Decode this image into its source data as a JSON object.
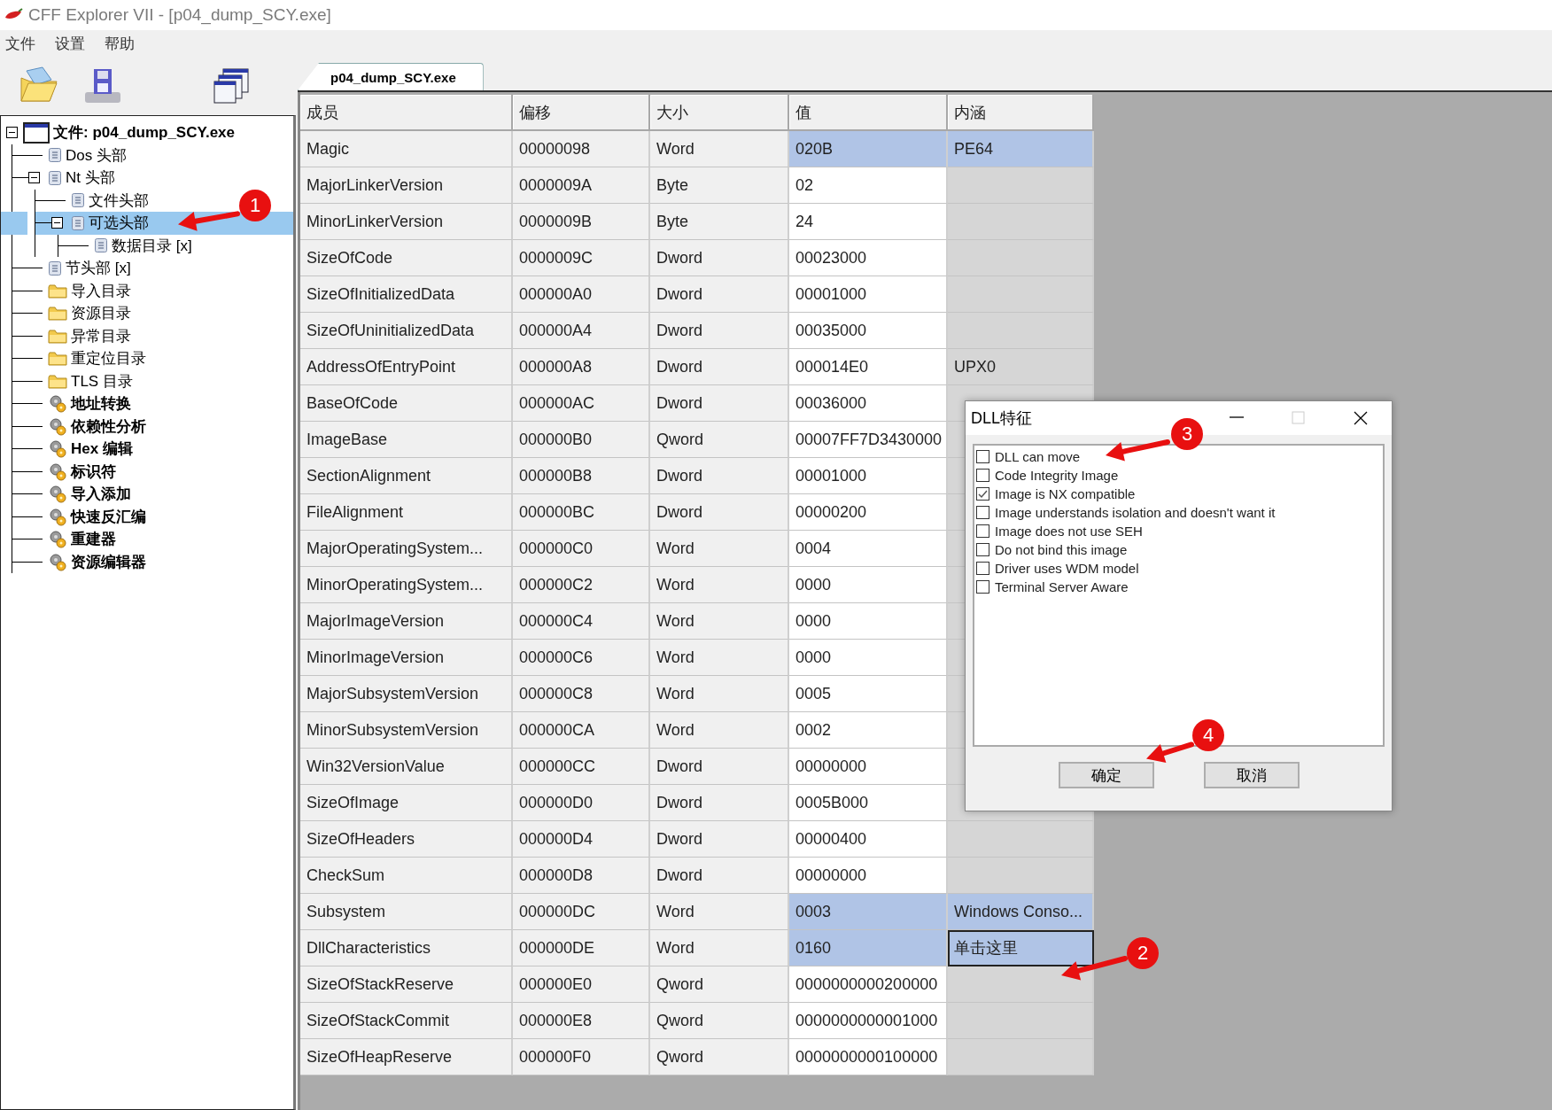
{
  "window": {
    "title": "CFF Explorer VII - [p04_dump_SCY.exe]"
  },
  "menu": [
    "文件",
    "设置",
    "帮助"
  ],
  "toolbar": [
    {
      "kind": "open"
    },
    {
      "kind": "save"
    },
    {
      "kind": "windows"
    }
  ],
  "tree": [
    {
      "label": "文件: p04_dump_SCY.exe",
      "kind": "window",
      "expanded": true,
      "selected": false,
      "children": [
        {
          "label": "Dos 头部",
          "kind": "doc",
          "selected": false
        },
        {
          "label": "Nt 头部",
          "kind": "doc",
          "expanded": true,
          "selected": false,
          "children": [
            {
              "label": "文件头部",
              "kind": "doc",
              "selected": false
            },
            {
              "label": "可选头部",
              "kind": "doc",
              "expanded": true,
              "selected": true,
              "children": [
                {
                  "label": "数据目录 [x]",
                  "kind": "doc",
                  "selected": false
                }
              ]
            }
          ]
        },
        {
          "label": "节头部 [x]",
          "kind": "doc",
          "selected": false
        },
        {
          "label": "导入目录",
          "kind": "folder",
          "selected": false
        },
        {
          "label": "资源目录",
          "kind": "folder",
          "selected": false
        },
        {
          "label": "异常目录",
          "kind": "folder",
          "selected": false
        },
        {
          "label": "重定位目录",
          "kind": "folder",
          "selected": false
        },
        {
          "label": "TLS 目录",
          "kind": "folder",
          "selected": false
        },
        {
          "label": "地址转换",
          "kind": "tool",
          "selected": false
        },
        {
          "label": "依赖性分析",
          "kind": "tool",
          "selected": false
        },
        {
          "label": "Hex 编辑",
          "kind": "tool",
          "selected": false
        },
        {
          "label": "标识符",
          "kind": "tool",
          "selected": false
        },
        {
          "label": "导入添加",
          "kind": "tool",
          "selected": false
        },
        {
          "label": "快速反汇编",
          "kind": "tool",
          "selected": false
        },
        {
          "label": "重建器",
          "kind": "tool",
          "selected": false
        },
        {
          "label": "资源编辑器",
          "kind": "tool",
          "selected": false
        }
      ]
    }
  ],
  "tabs": [
    {
      "label": "p04_dump_SCY.exe",
      "selected": true
    }
  ],
  "table": {
    "columns": [
      "成员",
      "偏移",
      "大小",
      "值",
      "内涵"
    ],
    "rows": [
      {
        "cells": [
          "Magic",
          "00000098",
          "Word",
          "020B",
          "PE64"
        ],
        "selected": true,
        "focused": false
      },
      {
        "cells": [
          "MajorLinkerVersion",
          "0000009A",
          "Byte",
          "02"
        ],
        "selected": false,
        "focused": false
      },
      {
        "cells": [
          "MinorLinkerVersion",
          "0000009B",
          "Byte",
          "24"
        ],
        "selected": false,
        "focused": false
      },
      {
        "cells": [
          "SizeOfCode",
          "0000009C",
          "Dword",
          "00023000"
        ],
        "selected": false,
        "focused": false
      },
      {
        "cells": [
          "SizeOfInitializedData",
          "000000A0",
          "Dword",
          "00001000"
        ],
        "selected": false,
        "focused": false
      },
      {
        "cells": [
          "SizeOfUninitializedData",
          "000000A4",
          "Dword",
          "00035000"
        ],
        "selected": false,
        "focused": false
      },
      {
        "cells": [
          "AddressOfEntryPoint",
          "000000A8",
          "Dword",
          "000014E0",
          "UPX0"
        ],
        "selected": false,
        "focused": false
      },
      {
        "cells": [
          "BaseOfCode",
          "000000AC",
          "Dword",
          "00036000"
        ],
        "selected": false,
        "focused": false
      },
      {
        "cells": [
          "ImageBase",
          "000000B0",
          "Qword",
          "00007FF7D3430000"
        ],
        "selected": false,
        "focused": false
      },
      {
        "cells": [
          "SectionAlignment",
          "000000B8",
          "Dword",
          "00001000"
        ],
        "selected": false,
        "focused": false
      },
      {
        "cells": [
          "FileAlignment",
          "000000BC",
          "Dword",
          "00000200"
        ],
        "selected": false,
        "focused": false
      },
      {
        "cells": [
          "MajorOperatingSystem...",
          "000000C0",
          "Word",
          "0004"
        ],
        "selected": false,
        "focused": false
      },
      {
        "cells": [
          "MinorOperatingSystem...",
          "000000C2",
          "Word",
          "0000"
        ],
        "selected": false,
        "focused": false
      },
      {
        "cells": [
          "MajorImageVersion",
          "000000C4",
          "Word",
          "0000"
        ],
        "selected": false,
        "focused": false
      },
      {
        "cells": [
          "MinorImageVersion",
          "000000C6",
          "Word",
          "0000"
        ],
        "selected": false,
        "focused": false
      },
      {
        "cells": [
          "MajorSubsystemVersion",
          "000000C8",
          "Word",
          "0005"
        ],
        "selected": false,
        "focused": false
      },
      {
        "cells": [
          "MinorSubsystemVersion",
          "000000CA",
          "Word",
          "0002"
        ],
        "selected": false,
        "focused": false
      },
      {
        "cells": [
          "Win32VersionValue",
          "000000CC",
          "Dword",
          "00000000"
        ],
        "selected": false,
        "focused": false
      },
      {
        "cells": [
          "SizeOfImage",
          "000000D0",
          "Dword",
          "0005B000"
        ],
        "selected": false,
        "focused": false
      },
      {
        "cells": [
          "SizeOfHeaders",
          "000000D4",
          "Dword",
          "00000400"
        ],
        "selected": false,
        "focused": false
      },
      {
        "cells": [
          "CheckSum",
          "000000D8",
          "Dword",
          "00000000"
        ],
        "selected": false,
        "focused": false
      },
      {
        "cells": [
          "Subsystem",
          "000000DC",
          "Word",
          "0003",
          "Windows Conso..."
        ],
        "selected": true,
        "focused": false
      },
      {
        "cells": [
          "DllCharacteristics",
          "000000DE",
          "Word",
          "0160",
          "单击这里"
        ],
        "selected": true,
        "focused": true
      },
      {
        "cells": [
          "SizeOfStackReserve",
          "000000E0",
          "Qword",
          "0000000000200000"
        ],
        "selected": false,
        "focused": false
      },
      {
        "cells": [
          "SizeOfStackCommit",
          "000000E8",
          "Qword",
          "0000000000001000"
        ],
        "selected": false,
        "focused": false
      },
      {
        "cells": [
          "SizeOfHeapReserve",
          "000000F0",
          "Qword",
          "0000000000100000"
        ],
        "selected": false,
        "focused": false
      }
    ]
  },
  "dialog": {
    "title": "DLL特征",
    "options": [
      {
        "label": "DLL can move",
        "checked": false
      },
      {
        "label": "Code Integrity Image",
        "checked": false
      },
      {
        "label": "Image is NX compatible",
        "checked": true
      },
      {
        "label": "Image understands isolation and doesn't want it",
        "checked": false
      },
      {
        "label": "Image does not use SEH",
        "checked": false
      },
      {
        "label": "Do not bind this image",
        "checked": false
      },
      {
        "label": "Driver uses WDM model",
        "checked": false
      },
      {
        "label": "Terminal Server Aware",
        "checked": false
      }
    ],
    "buttons": [
      "确定",
      "取消"
    ]
  },
  "annotations": [
    {
      "number": "1"
    },
    {
      "number": "2"
    },
    {
      "number": "3"
    },
    {
      "number": "4"
    }
  ]
}
